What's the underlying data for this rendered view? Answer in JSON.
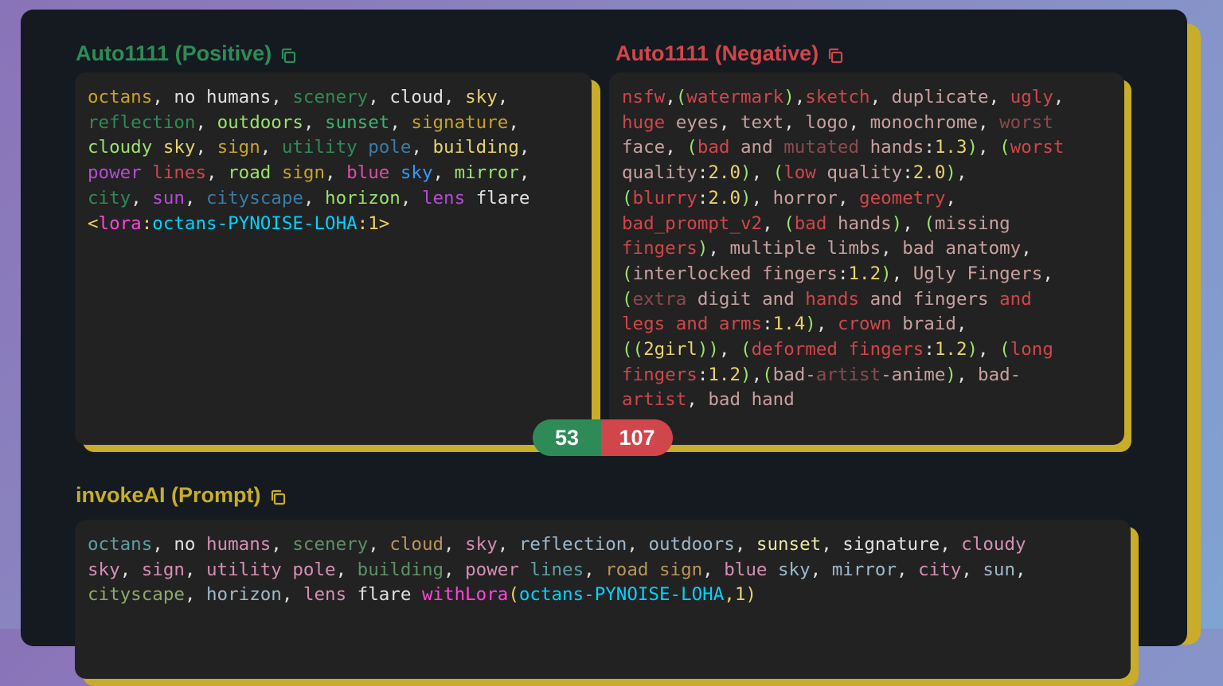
{
  "positive": {
    "title": "Auto1111 (Positive)",
    "icon": "copy-icon",
    "color": "#2e8b57",
    "lines": [
      [
        [
          "octans",
          "#c9a227"
        ],
        [
          ", ",
          "#e0e0e0"
        ],
        [
          "no",
          "#e0e0e0"
        ],
        [
          " ",
          "#e0e0e0"
        ],
        [
          "humans",
          "#e0e0e0"
        ],
        [
          ", ",
          "#e0e0e0"
        ],
        [
          "scenery",
          "#2e8b57"
        ],
        [
          ", ",
          "#e0e0e0"
        ],
        [
          "cloud",
          "#e0e0e0"
        ],
        [
          ", ",
          "#e0e0e0"
        ],
        [
          "sky",
          "#e8d36a"
        ],
        [
          ",",
          "#e0e0e0"
        ]
      ],
      [
        [
          "reflection",
          "#2e8b57"
        ],
        [
          ", ",
          "#e0e0e0"
        ],
        [
          "outdoors",
          "#9be36b"
        ],
        [
          ", ",
          "#e0e0e0"
        ],
        [
          "sunset",
          "#3cb371"
        ],
        [
          ", ",
          "#e0e0e0"
        ],
        [
          "signature",
          "#c9a227"
        ],
        [
          ",",
          "#e0e0e0"
        ]
      ],
      [
        [
          "cloudy",
          "#9be36b"
        ],
        [
          " ",
          "#e0e0e0"
        ],
        [
          "sky",
          "#e8d36a"
        ],
        [
          ", ",
          "#e0e0e0"
        ],
        [
          "sign",
          "#c9a227"
        ],
        [
          ", ",
          "#e0e0e0"
        ],
        [
          "utility",
          "#2e8b57"
        ],
        [
          " ",
          "#e0e0e0"
        ],
        [
          "pole",
          "#3a7ca5"
        ],
        [
          ", ",
          "#e0e0e0"
        ],
        [
          "building",
          "#e8d36a"
        ],
        [
          ",",
          "#e0e0e0"
        ]
      ],
      [
        [
          "power",
          "#b74bd6"
        ],
        [
          " ",
          "#e0e0e0"
        ],
        [
          "lines",
          "#d0464a"
        ],
        [
          ", ",
          "#e0e0e0"
        ],
        [
          "road",
          "#9be36b"
        ],
        [
          " ",
          "#e0e0e0"
        ],
        [
          "sign",
          "#c9a227"
        ],
        [
          ", ",
          "#e0e0e0"
        ],
        [
          "blue",
          "#d94fa3"
        ],
        [
          " ",
          "#e0e0e0"
        ],
        [
          "sky",
          "#3399ff"
        ],
        [
          ", ",
          "#e0e0e0"
        ],
        [
          "mirror",
          "#9be36b"
        ],
        [
          ",",
          "#e0e0e0"
        ]
      ],
      [
        [
          "city",
          "#2e8b57"
        ],
        [
          ", ",
          "#e0e0e0"
        ],
        [
          "sun",
          "#b74bd6"
        ],
        [
          ", ",
          "#e0e0e0"
        ],
        [
          "cityscape",
          "#3a7ca5"
        ],
        [
          ", ",
          "#e0e0e0"
        ],
        [
          "horizon",
          "#9be36b"
        ],
        [
          ", ",
          "#e0e0e0"
        ],
        [
          "lens",
          "#b74bd6"
        ],
        [
          " ",
          "#e0e0e0"
        ],
        [
          "flare",
          "#e0e0e0"
        ]
      ],
      [
        [
          "<",
          "#e8d36a"
        ],
        [
          "lora",
          "#ff44dd"
        ],
        [
          ":",
          "#e8d36a"
        ],
        [
          "octans-PYNOISE-LOHA",
          "#00d2ff"
        ],
        [
          ":",
          "#e8d36a"
        ],
        [
          "1",
          "#e8d36a"
        ],
        [
          ">",
          "#e8d36a"
        ]
      ]
    ]
  },
  "negative": {
    "title": "Auto1111 (Negative)",
    "icon": "copy-icon",
    "color": "#d0464a",
    "lines": [
      [
        [
          "nsfw",
          "#d0464a"
        ],
        [
          ",",
          "#e0e0e0"
        ],
        [
          "(",
          "#9be36b"
        ],
        [
          "watermark",
          "#d0464a"
        ],
        [
          ")",
          "#9be36b"
        ],
        [
          ",",
          "#e0e0e0"
        ],
        [
          "sketch",
          "#d0464a"
        ],
        [
          ", ",
          "#e0e0e0"
        ],
        [
          "duplicate",
          "#c9a0a0"
        ],
        [
          ", ",
          "#e0e0e0"
        ],
        [
          "ugly",
          "#d0464a"
        ],
        [
          ",",
          "#e0e0e0"
        ]
      ],
      [
        [
          "huge",
          "#d0464a"
        ],
        [
          " ",
          "#e0e0e0"
        ],
        [
          "eyes",
          "#c9a0a0"
        ],
        [
          ", ",
          "#e0e0e0"
        ],
        [
          "text",
          "#c9a0a0"
        ],
        [
          ", ",
          "#e0e0e0"
        ],
        [
          "logo",
          "#c9a0a0"
        ],
        [
          ", ",
          "#e0e0e0"
        ],
        [
          "monochrome",
          "#c9a0a0"
        ],
        [
          ", ",
          "#e0e0e0"
        ],
        [
          "worst",
          "#8a4a4e"
        ]
      ],
      [
        [
          "face",
          "#c9a0a0"
        ],
        [
          ", ",
          "#e0e0e0"
        ],
        [
          "(",
          "#9be36b"
        ],
        [
          "bad",
          "#d0464a"
        ],
        [
          " ",
          "#e0e0e0"
        ],
        [
          "and",
          "#c9a0a0"
        ],
        [
          " ",
          "#e0e0e0"
        ],
        [
          "mutated",
          "#8a4a4e"
        ],
        [
          " ",
          "#e0e0e0"
        ],
        [
          "hands",
          "#c9a0a0"
        ],
        [
          ":",
          "#e0e0e0"
        ],
        [
          "1.3",
          "#e8d36a"
        ],
        [
          ")",
          "#9be36b"
        ],
        [
          ", ",
          "#e0e0e0"
        ],
        [
          "(",
          "#9be36b"
        ],
        [
          "worst",
          "#d0464a"
        ]
      ],
      [
        [
          "quality",
          "#c9a0a0"
        ],
        [
          ":",
          "#e0e0e0"
        ],
        [
          "2.0",
          "#e8d36a"
        ],
        [
          ")",
          "#9be36b"
        ],
        [
          ", ",
          "#e0e0e0"
        ],
        [
          "(",
          "#9be36b"
        ],
        [
          "low",
          "#d0464a"
        ],
        [
          " ",
          "#e0e0e0"
        ],
        [
          "quality",
          "#c9a0a0"
        ],
        [
          ":",
          "#e0e0e0"
        ],
        [
          "2.0",
          "#e8d36a"
        ],
        [
          ")",
          "#9be36b"
        ],
        [
          ",",
          "#e0e0e0"
        ]
      ],
      [
        [
          "(",
          "#9be36b"
        ],
        [
          "blurry",
          "#d0464a"
        ],
        [
          ":",
          "#e0e0e0"
        ],
        [
          "2.0",
          "#e8d36a"
        ],
        [
          ")",
          "#9be36b"
        ],
        [
          ", ",
          "#e0e0e0"
        ],
        [
          "horror",
          "#c9a0a0"
        ],
        [
          ", ",
          "#e0e0e0"
        ],
        [
          "geometry",
          "#d0464a"
        ],
        [
          ",",
          "#e0e0e0"
        ]
      ],
      [
        [
          "bad_prompt_v2",
          "#d0464a"
        ],
        [
          ", ",
          "#e0e0e0"
        ],
        [
          "(",
          "#9be36b"
        ],
        [
          "bad",
          "#d0464a"
        ],
        [
          " ",
          "#e0e0e0"
        ],
        [
          "hands",
          "#c9a0a0"
        ],
        [
          ")",
          "#9be36b"
        ],
        [
          ", ",
          "#e0e0e0"
        ],
        [
          "(",
          "#9be36b"
        ],
        [
          "missing",
          "#c9a0a0"
        ]
      ],
      [
        [
          "fingers",
          "#d0464a"
        ],
        [
          ")",
          "#9be36b"
        ],
        [
          ", ",
          "#e0e0e0"
        ],
        [
          "multiple",
          "#c9a0a0"
        ],
        [
          " ",
          "#e0e0e0"
        ],
        [
          "limbs",
          "#c9a0a0"
        ],
        [
          ", ",
          "#e0e0e0"
        ],
        [
          "bad",
          "#c9a0a0"
        ],
        [
          " ",
          "#e0e0e0"
        ],
        [
          "anatomy",
          "#c9a0a0"
        ],
        [
          ",",
          "#e0e0e0"
        ]
      ],
      [
        [
          "(",
          "#9be36b"
        ],
        [
          "interlocked",
          "#c9a0a0"
        ],
        [
          " ",
          "#e0e0e0"
        ],
        [
          "fingers",
          "#c9a0a0"
        ],
        [
          ":",
          "#e0e0e0"
        ],
        [
          "1.2",
          "#e8d36a"
        ],
        [
          ")",
          "#9be36b"
        ],
        [
          ", ",
          "#e0e0e0"
        ],
        [
          "Ugly",
          "#c9a0a0"
        ],
        [
          " ",
          "#e0e0e0"
        ],
        [
          "Fingers",
          "#c9a0a0"
        ],
        [
          ",",
          "#e0e0e0"
        ]
      ],
      [
        [
          "(",
          "#9be36b"
        ],
        [
          "extra",
          "#8a4a4e"
        ],
        [
          " ",
          "#e0e0e0"
        ],
        [
          "digit",
          "#c9a0a0"
        ],
        [
          " ",
          "#e0e0e0"
        ],
        [
          "and",
          "#c9a0a0"
        ],
        [
          " ",
          "#e0e0e0"
        ],
        [
          "hands",
          "#d0464a"
        ],
        [
          " ",
          "#e0e0e0"
        ],
        [
          "and",
          "#c9a0a0"
        ],
        [
          " ",
          "#e0e0e0"
        ],
        [
          "fingers",
          "#c9a0a0"
        ],
        [
          " ",
          "#e0e0e0"
        ],
        [
          "and",
          "#d0464a"
        ]
      ],
      [
        [
          "legs",
          "#d0464a"
        ],
        [
          " ",
          "#e0e0e0"
        ],
        [
          "and",
          "#d0464a"
        ],
        [
          " ",
          "#e0e0e0"
        ],
        [
          "arms",
          "#d0464a"
        ],
        [
          ":",
          "#e0e0e0"
        ],
        [
          "1.4",
          "#e8d36a"
        ],
        [
          ")",
          "#9be36b"
        ],
        [
          ", ",
          "#e0e0e0"
        ],
        [
          "crown",
          "#d0464a"
        ],
        [
          " ",
          "#e0e0e0"
        ],
        [
          "braid",
          "#c9a0a0"
        ],
        [
          ",",
          "#e0e0e0"
        ]
      ],
      [
        [
          "((",
          "#9be36b"
        ],
        [
          "2girl",
          "#e8d36a"
        ],
        [
          "))",
          "#9be36b"
        ],
        [
          ", ",
          "#e0e0e0"
        ],
        [
          "(",
          "#9be36b"
        ],
        [
          "deformed",
          "#d0464a"
        ],
        [
          " ",
          "#e0e0e0"
        ],
        [
          "fingers",
          "#d0464a"
        ],
        [
          ":",
          "#e0e0e0"
        ],
        [
          "1.2",
          "#e8d36a"
        ],
        [
          ")",
          "#9be36b"
        ],
        [
          ", ",
          "#e0e0e0"
        ],
        [
          "(",
          "#9be36b"
        ],
        [
          "long",
          "#d0464a"
        ]
      ],
      [
        [
          "fingers",
          "#d0464a"
        ],
        [
          ":",
          "#e0e0e0"
        ],
        [
          "1.2",
          "#e8d36a"
        ],
        [
          ")",
          "#9be36b"
        ],
        [
          ",",
          "#e0e0e0"
        ],
        [
          "(",
          "#9be36b"
        ],
        [
          "bad-",
          "#c9a0a0"
        ],
        [
          "artist",
          "#8a4a4e"
        ],
        [
          "-anime",
          "#c9a0a0"
        ],
        [
          ")",
          "#9be36b"
        ],
        [
          ", ",
          "#e0e0e0"
        ],
        [
          "bad-",
          "#c9a0a0"
        ]
      ],
      [
        [
          "artist",
          "#d0464a"
        ],
        [
          ", ",
          "#e0e0e0"
        ],
        [
          "bad",
          "#c9a0a0"
        ],
        [
          " ",
          "#e0e0e0"
        ],
        [
          "hand",
          "#c9a0a0"
        ]
      ]
    ]
  },
  "counts": {
    "positive": "53",
    "negative": "107"
  },
  "invoke": {
    "title": "invokeAI (Prompt)",
    "icon": "copy-icon",
    "color": "#c9ad2a",
    "lines": [
      [
        [
          "octans",
          "#5f9ea0"
        ],
        [
          ", ",
          "#e0e0e0"
        ],
        [
          "no",
          "#e0e0e0"
        ],
        [
          " ",
          "#e0e0e0"
        ],
        [
          "humans",
          "#d68fb4"
        ],
        [
          ", ",
          "#e0e0e0"
        ],
        [
          "scenery",
          "#5f8f6a"
        ],
        [
          ", ",
          "#e0e0e0"
        ],
        [
          "cloud",
          "#b8955a"
        ],
        [
          ", ",
          "#e0e0e0"
        ],
        [
          "sky",
          "#d68fb4"
        ],
        [
          ", ",
          "#e0e0e0"
        ],
        [
          "reflection",
          "#9fb8c8"
        ],
        [
          ", ",
          "#e0e0e0"
        ],
        [
          "outdoors",
          "#9fb8c8"
        ],
        [
          ", ",
          "#e0e0e0"
        ],
        [
          "sunset",
          "#e8e8a0"
        ],
        [
          ", ",
          "#e0e0e0"
        ],
        [
          "signature",
          "#e0e0e0"
        ],
        [
          ", ",
          "#e0e0e0"
        ],
        [
          "cloudy",
          "#d68fb4"
        ]
      ],
      [
        [
          "sky",
          "#d68fb4"
        ],
        [
          ", ",
          "#e0e0e0"
        ],
        [
          "sign",
          "#d68fb4"
        ],
        [
          ", ",
          "#e0e0e0"
        ],
        [
          "utility",
          "#d68fb4"
        ],
        [
          " ",
          "#e0e0e0"
        ],
        [
          "pole",
          "#d68fb4"
        ],
        [
          ", ",
          "#e0e0e0"
        ],
        [
          "building",
          "#5f8f6a"
        ],
        [
          ", ",
          "#e0e0e0"
        ],
        [
          "power",
          "#d68fb4"
        ],
        [
          " ",
          "#e0e0e0"
        ],
        [
          "lines",
          "#5f9ea0"
        ],
        [
          ", ",
          "#e0e0e0"
        ],
        [
          "road",
          "#b8955a"
        ],
        [
          " ",
          "#e0e0e0"
        ],
        [
          "sign",
          "#b8955a"
        ],
        [
          ", ",
          "#e0e0e0"
        ],
        [
          "blue",
          "#d68fb4"
        ],
        [
          " ",
          "#e0e0e0"
        ],
        [
          "sky",
          "#9fb8c8"
        ],
        [
          ", ",
          "#e0e0e0"
        ],
        [
          "mirror",
          "#9fb8c8"
        ],
        [
          ", ",
          "#e0e0e0"
        ],
        [
          "city",
          "#d68fb4"
        ],
        [
          ", ",
          "#e0e0e0"
        ],
        [
          "sun",
          "#9fb8c8"
        ],
        [
          ",",
          "#e0e0e0"
        ]
      ],
      [
        [
          "cityscape",
          "#8fa86a"
        ],
        [
          ", ",
          "#e0e0e0"
        ],
        [
          "horizon",
          "#9fb8c8"
        ],
        [
          ", ",
          "#e0e0e0"
        ],
        [
          "lens",
          "#d68fb4"
        ],
        [
          " ",
          "#e0e0e0"
        ],
        [
          "flare",
          "#e0e0e0"
        ],
        [
          " ",
          "#e0e0e0"
        ],
        [
          "withLora",
          "#ff44dd"
        ],
        [
          "(",
          "#e8d36a"
        ],
        [
          "octans-PYNOISE-LOHA",
          "#00d2ff"
        ],
        [
          ",",
          "#e8d36a"
        ],
        [
          "1",
          "#e8d36a"
        ],
        [
          ")",
          "#e8d36a"
        ]
      ]
    ]
  }
}
